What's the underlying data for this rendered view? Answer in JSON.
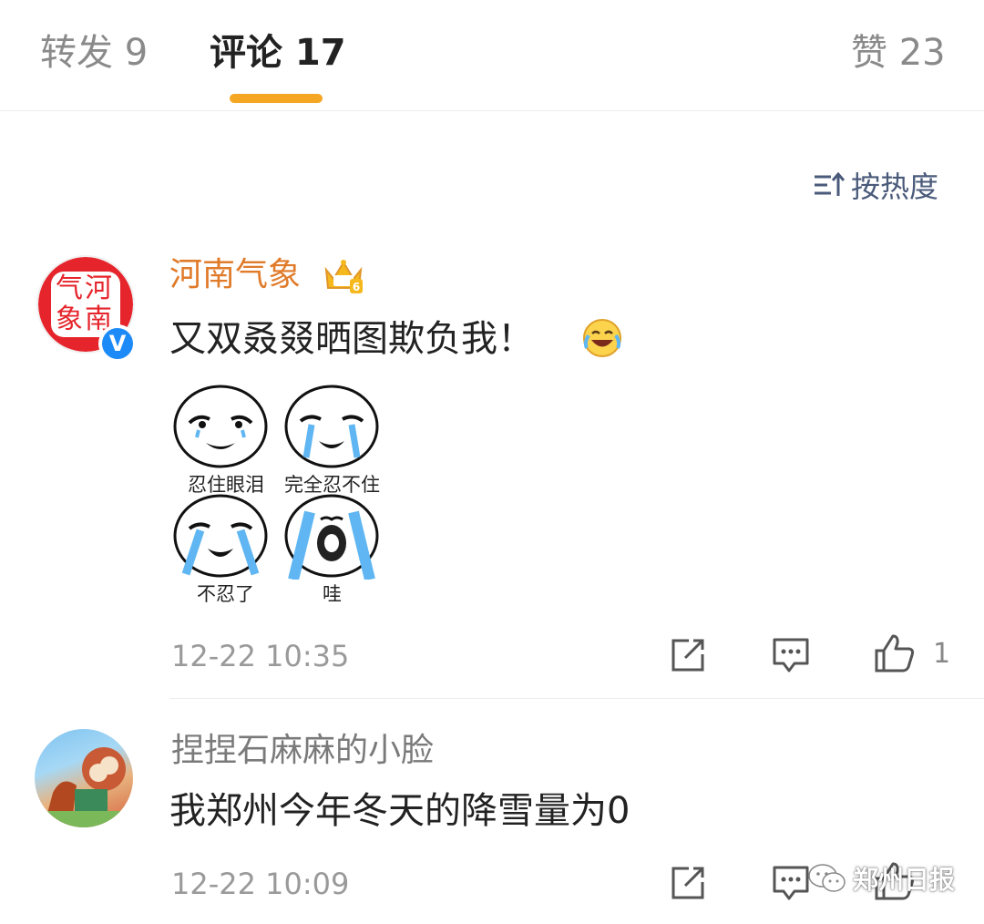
{
  "tabs": {
    "repost": "转发 9",
    "comments": "评论 17",
    "likes": "赞 23",
    "active": "comments",
    "accent_color": "#f5a623"
  },
  "sort": {
    "label": "按热度",
    "icon": "sort-icon"
  },
  "comments": [
    {
      "username": "河南气象",
      "avatar_text": [
        "河",
        "南",
        "气",
        "象"
      ],
      "verified": true,
      "badge_icon": "crown-level-6-icon",
      "text": "又双叒叕晒图欺负我！",
      "emoji": "laugh-cry-icon",
      "stickers": [
        "忍住眼泪",
        "完全忍不住",
        "不忍了",
        "哇"
      ],
      "timestamp": "12-22 10:35",
      "like_count": "1"
    },
    {
      "username": "捏捏石麻麻的小脸",
      "text": "我郑州今年冬天的降雪量为0",
      "timestamp": "12-22 10:09",
      "like_count": ""
    }
  ],
  "watermark": "郑州日报",
  "colors": {
    "username_official": "#e07b2a",
    "username_normal": "#7a7a7a",
    "verified_blue": "#1c8af7",
    "sort_text": "#4a5a7a"
  }
}
